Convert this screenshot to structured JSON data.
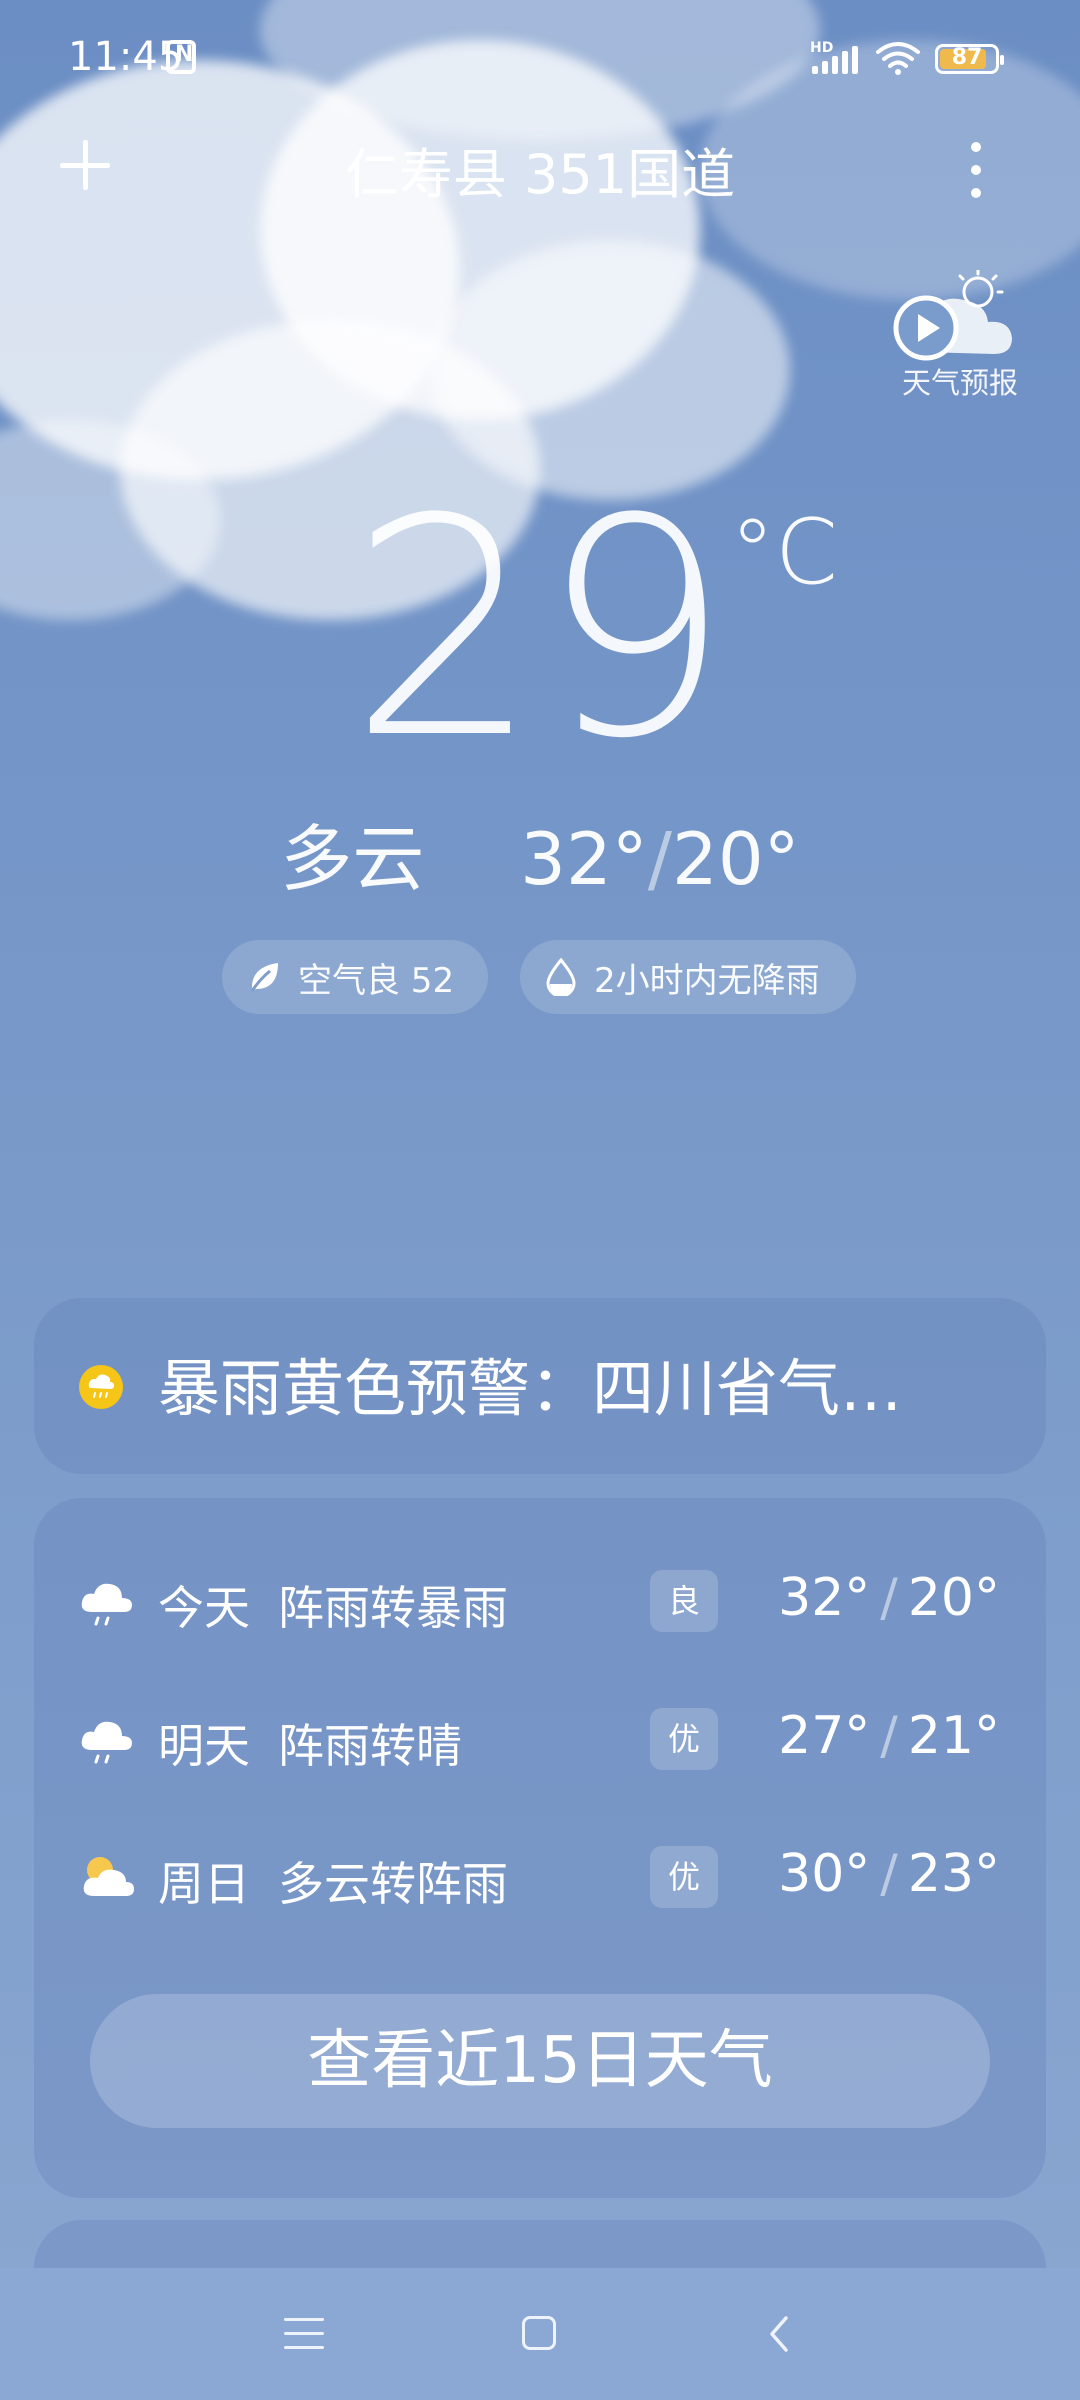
{
  "status": {
    "time": "11:45",
    "network_label": "HD",
    "battery": "87",
    "battery_level": 0.87,
    "battery_color": "#f0b94b"
  },
  "header": {
    "location": "仁寿县 351国道",
    "forecast_video_label": "天气预报"
  },
  "current": {
    "temperature": "29",
    "unit": "°C",
    "condition": "多云",
    "high": "32°",
    "low": "20°"
  },
  "chips": {
    "air": "空气良 52",
    "rain": "2小时内无降雨"
  },
  "alert": {
    "text": "暴雨黄色预警：四川省气…",
    "color": "#f5c518"
  },
  "forecast": [
    {
      "day": "今天",
      "condition": "阵雨转暴雨",
      "aqi": "良",
      "high": "32°",
      "low": "20°",
      "icon": "rain-cloud-icon"
    },
    {
      "day": "明天",
      "condition": "阵雨转晴",
      "aqi": "优",
      "high": "27°",
      "low": "21°",
      "icon": "rain-cloud-icon"
    },
    {
      "day": "周日",
      "condition": "多云转阵雨",
      "aqi": "优",
      "high": "30°",
      "low": "23°",
      "icon": "partly-cloudy-icon"
    }
  ],
  "forecast_button": "查看近15日天气",
  "forecast_separator": "/"
}
